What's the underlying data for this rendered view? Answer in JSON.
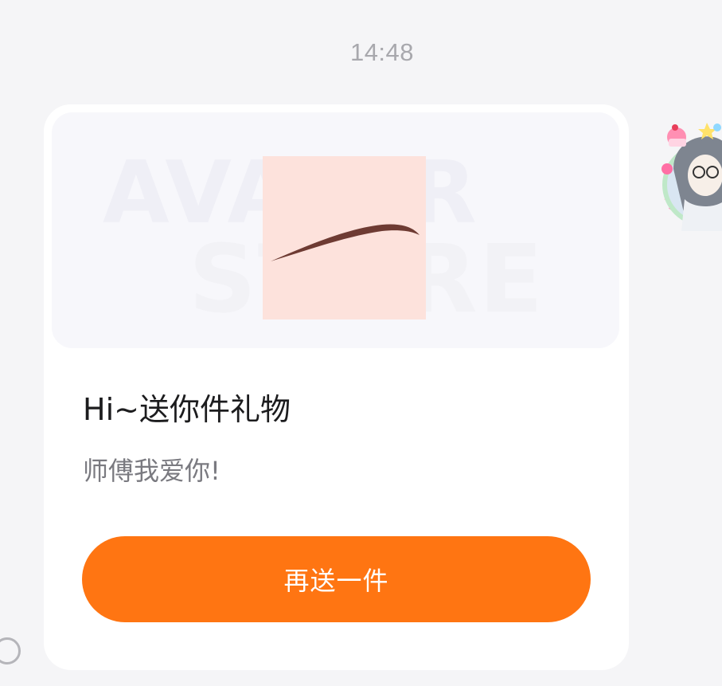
{
  "chat": {
    "timestamp": "14:48"
  },
  "gift_card": {
    "watermark_top": "AVATAR",
    "watermark_bottom": "STORE",
    "item_image_icon": "eyebrow-item",
    "title": "Hi~送你件礼物",
    "message": "师傅我爱你!",
    "resend_button_label": "再送一件"
  },
  "sender": {
    "avatar_icon": "anime-character-avatar"
  },
  "colors": {
    "accent": "#ff7512",
    "background": "#f5f5f7",
    "card": "#ffffff",
    "item_background": "#fde2dc",
    "eyebrow": "#6e3b33"
  }
}
